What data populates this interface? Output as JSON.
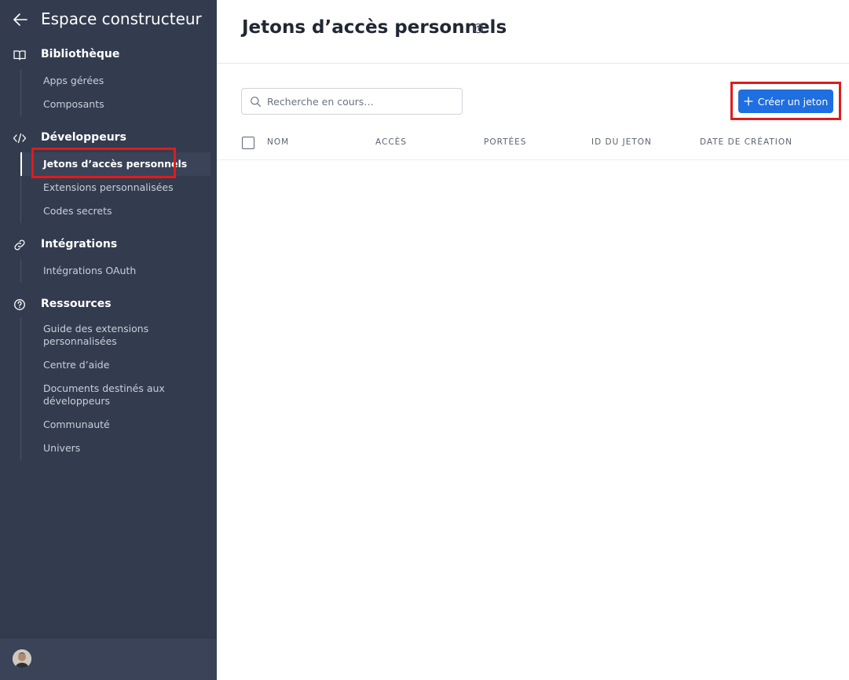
{
  "sidebar": {
    "title": "Espace constructeur",
    "sections": [
      {
        "label": "Bibliothèque",
        "icon": "book-icon",
        "items": [
          {
            "label": "Apps gérées"
          },
          {
            "label": "Composants"
          }
        ]
      },
      {
        "label": "Développeurs",
        "icon": "code-icon",
        "items": [
          {
            "label": "Jetons d’accès personnels",
            "active": true
          },
          {
            "label": "Extensions personnalisées"
          },
          {
            "label": "Codes secrets"
          }
        ]
      },
      {
        "label": "Intégrations",
        "icon": "link-icon",
        "items": [
          {
            "label": "Intégrations OAuth"
          }
        ]
      },
      {
        "label": "Ressources",
        "icon": "question-circle-icon",
        "items": [
          {
            "label": "Guide des extensions personnalisées"
          },
          {
            "label": "Centre d’aide"
          },
          {
            "label": "Documents destinés aux développeurs"
          },
          {
            "label": "Communauté"
          },
          {
            "label": "Univers"
          }
        ]
      }
    ]
  },
  "main": {
    "title": "Jetons d’accès personnels",
    "search": {
      "placeholder": "Recherche en cours…",
      "value": ""
    },
    "create_button": "Créer un jeton",
    "columns": [
      "NOM",
      "ACCÈS",
      "PORTÉES",
      "ID DU JETON",
      "DATE DE CRÉATION"
    ]
  },
  "colors": {
    "sidebar_bg": "#333c4f",
    "accent": "#1f6fe0",
    "highlight": "#e01b1b"
  }
}
